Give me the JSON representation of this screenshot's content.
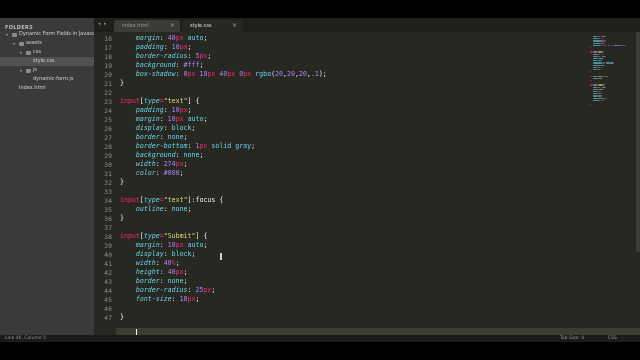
{
  "sidebar": {
    "title": "FOLDERS",
    "tree": [
      {
        "label": "Dynamic Form Fields in Javascript",
        "depth": 0,
        "type": "folder",
        "open": true
      },
      {
        "label": "assets",
        "depth": 1,
        "type": "folder",
        "open": true
      },
      {
        "label": "css",
        "depth": 2,
        "type": "folder",
        "open": true
      },
      {
        "label": "style.css",
        "depth": 3,
        "type": "file",
        "selected": true
      },
      {
        "label": "js",
        "depth": 2,
        "type": "folder",
        "open": true
      },
      {
        "label": "dynamic-form.js",
        "depth": 3,
        "type": "file"
      },
      {
        "label": "index.html",
        "depth": 1,
        "type": "file"
      }
    ]
  },
  "tabs": {
    "nav_prev": "◂",
    "nav_next": "▸",
    "items": [
      {
        "label": "index.html",
        "active": false,
        "close": "×"
      },
      {
        "label": "style.css",
        "active": true,
        "close": "×"
      }
    ]
  },
  "editor": {
    "lines": [
      {
        "num": "16",
        "tokens": [
          [
            "    ",
            "plain"
          ],
          [
            "margin",
            "prop"
          ],
          [
            ": ",
            "pun"
          ],
          [
            "40",
            "num"
          ],
          [
            "px",
            "unit"
          ],
          [
            " ",
            "plain"
          ],
          [
            "auto",
            "val"
          ],
          [
            ";",
            "pun"
          ]
        ]
      },
      {
        "num": "17",
        "tokens": [
          [
            "    ",
            "plain"
          ],
          [
            "padding",
            "prop"
          ],
          [
            ": ",
            "pun"
          ],
          [
            "10",
            "num"
          ],
          [
            "px",
            "unit"
          ],
          [
            ";",
            "pun"
          ]
        ]
      },
      {
        "num": "18",
        "tokens": [
          [
            "    ",
            "plain"
          ],
          [
            "border-radius",
            "prop"
          ],
          [
            ": ",
            "pun"
          ],
          [
            "5",
            "num"
          ],
          [
            "px",
            "unit"
          ],
          [
            ";",
            "pun"
          ]
        ]
      },
      {
        "num": "19",
        "tokens": [
          [
            "    ",
            "plain"
          ],
          [
            "background",
            "prop"
          ],
          [
            ": ",
            "pun"
          ],
          [
            "#fff",
            "num"
          ],
          [
            ";",
            "pun"
          ]
        ]
      },
      {
        "num": "20",
        "tokens": [
          [
            "    ",
            "plain"
          ],
          [
            "box-shadow",
            "prop"
          ],
          [
            ": ",
            "pun"
          ],
          [
            "0",
            "num"
          ],
          [
            "px",
            "unit"
          ],
          [
            " ",
            "plain"
          ],
          [
            "10",
            "num"
          ],
          [
            "px",
            "unit"
          ],
          [
            " ",
            "plain"
          ],
          [
            "40",
            "num"
          ],
          [
            "px",
            "unit"
          ],
          [
            " ",
            "plain"
          ],
          [
            "0",
            "num"
          ],
          [
            "px",
            "unit"
          ],
          [
            " ",
            "plain"
          ],
          [
            "rgba",
            "val"
          ],
          [
            "(",
            "pun"
          ],
          [
            "20",
            "num"
          ],
          [
            ",",
            "pun"
          ],
          [
            "20",
            "num"
          ],
          [
            ",",
            "pun"
          ],
          [
            "20",
            "num"
          ],
          [
            ",",
            "pun"
          ],
          [
            ".1",
            "num"
          ],
          [
            ");",
            "pun"
          ]
        ]
      },
      {
        "num": "21",
        "tokens": [
          [
            "}",
            "pun"
          ]
        ]
      },
      {
        "num": "22",
        "tokens": []
      },
      {
        "num": "23",
        "tokens": [
          [
            "input",
            "sel"
          ],
          [
            "[",
            "pun"
          ],
          [
            "type",
            "tokprop"
          ],
          [
            "=",
            "sel"
          ],
          [
            "\"text\"",
            "str"
          ],
          [
            "]",
            "pun"
          ],
          [
            " {",
            "pun"
          ]
        ]
      },
      {
        "num": "24",
        "tokens": [
          [
            "    ",
            "plain"
          ],
          [
            "padding",
            "prop"
          ],
          [
            ": ",
            "pun"
          ],
          [
            "10",
            "num"
          ],
          [
            "px",
            "unit"
          ],
          [
            ";",
            "pun"
          ]
        ]
      },
      {
        "num": "25",
        "tokens": [
          [
            "    ",
            "plain"
          ],
          [
            "margin",
            "prop"
          ],
          [
            ": ",
            "pun"
          ],
          [
            "10",
            "num"
          ],
          [
            "px",
            "unit"
          ],
          [
            " ",
            "plain"
          ],
          [
            "auto",
            "val"
          ],
          [
            ";",
            "pun"
          ]
        ]
      },
      {
        "num": "26",
        "tokens": [
          [
            "    ",
            "plain"
          ],
          [
            "display",
            "prop"
          ],
          [
            ": ",
            "pun"
          ],
          [
            "block",
            "val"
          ],
          [
            ";",
            "pun"
          ]
        ]
      },
      {
        "num": "27",
        "tokens": [
          [
            "    ",
            "plain"
          ],
          [
            "border",
            "prop"
          ],
          [
            ": ",
            "pun"
          ],
          [
            "none",
            "val"
          ],
          [
            ";",
            "pun"
          ]
        ]
      },
      {
        "num": "28",
        "tokens": [
          [
            "    ",
            "plain"
          ],
          [
            "border-bottom",
            "prop"
          ],
          [
            ": ",
            "pun"
          ],
          [
            "1",
            "num"
          ],
          [
            "px",
            "unit"
          ],
          [
            " ",
            "plain"
          ],
          [
            "solid",
            "val"
          ],
          [
            " ",
            "plain"
          ],
          [
            "gray",
            "val"
          ],
          [
            ";",
            "pun"
          ]
        ]
      },
      {
        "num": "29",
        "tokens": [
          [
            "    ",
            "plain"
          ],
          [
            "background",
            "prop"
          ],
          [
            ": ",
            "pun"
          ],
          [
            "none",
            "val"
          ],
          [
            ";",
            "pun"
          ]
        ]
      },
      {
        "num": "30",
        "tokens": [
          [
            "    ",
            "plain"
          ],
          [
            "width",
            "prop"
          ],
          [
            ": ",
            "pun"
          ],
          [
            "274",
            "num"
          ],
          [
            "px",
            "unit"
          ],
          [
            ";",
            "pun"
          ]
        ]
      },
      {
        "num": "31",
        "tokens": [
          [
            "    ",
            "plain"
          ],
          [
            "color",
            "prop"
          ],
          [
            ": ",
            "pun"
          ],
          [
            "#000",
            "num"
          ],
          [
            ";",
            "pun"
          ]
        ]
      },
      {
        "num": "32",
        "tokens": [
          [
            "}",
            "pun"
          ]
        ]
      },
      {
        "num": "33",
        "tokens": []
      },
      {
        "num": "34",
        "tokens": [
          [
            "input",
            "sel"
          ],
          [
            "[",
            "pun"
          ],
          [
            "type",
            "tokprop"
          ],
          [
            "=",
            "sel"
          ],
          [
            "\"text\"",
            "str"
          ],
          [
            "]",
            "pun"
          ],
          [
            ":focus {",
            "pun"
          ]
        ]
      },
      {
        "num": "35",
        "tokens": [
          [
            "    ",
            "plain"
          ],
          [
            "outline",
            "prop"
          ],
          [
            ": ",
            "pun"
          ],
          [
            "none",
            "val"
          ],
          [
            ";",
            "pun"
          ]
        ]
      },
      {
        "num": "36",
        "tokens": [
          [
            "}",
            "pun"
          ]
        ]
      },
      {
        "num": "37",
        "tokens": []
      },
      {
        "num": "38",
        "tokens": [
          [
            "input",
            "sel"
          ],
          [
            "[",
            "pun"
          ],
          [
            "type",
            "tokprop"
          ],
          [
            "=",
            "sel"
          ],
          [
            "\"Submit\"",
            "str"
          ],
          [
            "]",
            "pun"
          ],
          [
            " {",
            "pun"
          ]
        ]
      },
      {
        "num": "39",
        "tokens": [
          [
            "    ",
            "plain"
          ],
          [
            "margin",
            "prop"
          ],
          [
            ": ",
            "pun"
          ],
          [
            "10",
            "num"
          ],
          [
            "px",
            "unit"
          ],
          [
            " ",
            "plain"
          ],
          [
            "auto",
            "val"
          ],
          [
            ";",
            "pun"
          ]
        ]
      },
      {
        "num": "40",
        "tokens": [
          [
            "    ",
            "plain"
          ],
          [
            "display",
            "prop"
          ],
          [
            ": ",
            "pun"
          ],
          [
            "block",
            "val"
          ],
          [
            ";",
            "pun"
          ]
        ]
      },
      {
        "num": "41",
        "tokens": [
          [
            "    ",
            "plain"
          ],
          [
            "width",
            "prop"
          ],
          [
            ": ",
            "pun"
          ],
          [
            "40",
            "num"
          ],
          [
            "%",
            "unit"
          ],
          [
            ";",
            "pun"
          ]
        ]
      },
      {
        "num": "42",
        "tokens": [
          [
            "    ",
            "plain"
          ],
          [
            "height",
            "prop"
          ],
          [
            ": ",
            "pun"
          ],
          [
            "40",
            "num"
          ],
          [
            "px",
            "unit"
          ],
          [
            ";",
            "pun"
          ]
        ]
      },
      {
        "num": "43",
        "tokens": [
          [
            "    ",
            "plain"
          ],
          [
            "border",
            "prop"
          ],
          [
            ": ",
            "pun"
          ],
          [
            "none",
            "val"
          ],
          [
            ";",
            "pun"
          ]
        ]
      },
      {
        "num": "44",
        "tokens": [
          [
            "    ",
            "plain"
          ],
          [
            "border-radius",
            "prop"
          ],
          [
            ": ",
            "pun"
          ],
          [
            "25",
            "num"
          ],
          [
            "px",
            "unit"
          ],
          [
            ";",
            "pun"
          ]
        ]
      },
      {
        "num": "45",
        "tokens": [
          [
            "    ",
            "plain"
          ],
          [
            "font-size",
            "prop"
          ],
          [
            ": ",
            "pun"
          ],
          [
            "18",
            "num"
          ],
          [
            "px",
            "unit"
          ],
          [
            ";",
            "pun"
          ]
        ]
      },
      {
        "num": "46",
        "tokens": []
      },
      {
        "num": "47",
        "tokens": [
          [
            "}",
            "pun"
          ]
        ]
      }
    ],
    "current_line": "46"
  },
  "statusbar": {
    "position": "Line 46, Column 5",
    "tab_size": "Tab Size: 4",
    "syntax": "CSS"
  },
  "colors": {
    "background": "#272822",
    "selector": "#f92672",
    "property": "#66d9ef",
    "number": "#ae81ff",
    "string": "#e6db74",
    "text": "#f8f8f2",
    "sidebar": "#3a3a3a"
  },
  "icons": {
    "folder": "folder-icon",
    "arrow": "disclosure-arrow-icon"
  }
}
